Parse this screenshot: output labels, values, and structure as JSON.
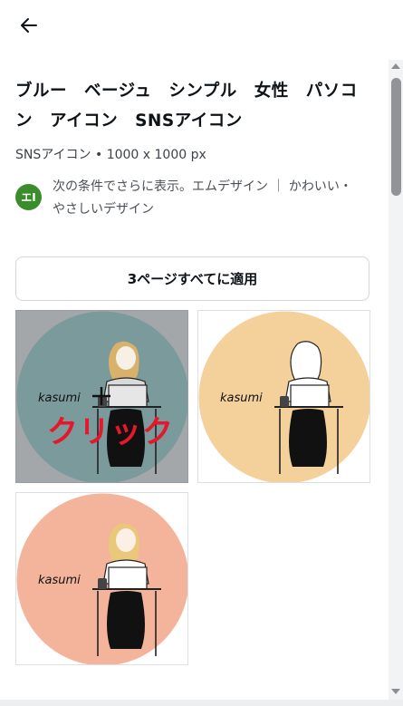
{
  "header": {
    "back_icon": "arrow-left-icon"
  },
  "template": {
    "title": "ブルー　ベージュ　シンプル　女性　パソコン　アイコン　SNSアイコン",
    "meta": "SNSアイコン • 1000 x 1000 px",
    "creator_initials": "エI",
    "creator_text": "次の条件でさらに表示。エムデザイン ｜ かわいい・やさしいデザイン",
    "apply_button": "3ページすべてに適用"
  },
  "pages": [
    {
      "name": "page-1",
      "bg_color": "#7a9a9c",
      "text": "kasumi",
      "selected": true,
      "overlay_text": "クリック"
    },
    {
      "name": "page-2",
      "bg_color": "#f4d09a",
      "text": "kasumi",
      "selected": false
    },
    {
      "name": "page-3",
      "bg_color": "#f3b49b",
      "text": "kasumi",
      "selected": false
    }
  ],
  "colors": {
    "accent_red": "#e6172b",
    "avatar_green": "#3a8c2c"
  }
}
